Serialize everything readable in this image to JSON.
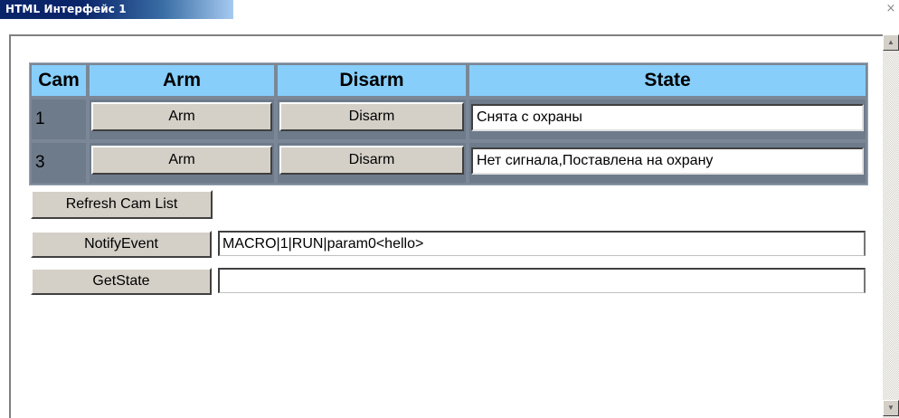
{
  "window": {
    "title": "HTML Интерфейс 1",
    "close_glyph": "×"
  },
  "scrollbar": {
    "up_glyph": "▲",
    "down_glyph": "▼"
  },
  "table": {
    "headers": [
      "Cam",
      "Arm",
      "Disarm",
      "State"
    ],
    "rows": [
      {
        "cam": "1",
        "arm_label": "Arm",
        "disarm_label": "Disarm",
        "state": "Снята с охраны"
      },
      {
        "cam": "3",
        "arm_label": "Arm",
        "disarm_label": "Disarm",
        "state": "Нет сигнала,Поставлена на охрану"
      }
    ]
  },
  "controls": {
    "refresh_label": "Refresh Cam List",
    "notify_label": "NotifyEvent",
    "notify_value": "MACRO|1|RUN|param0<hello>",
    "getstate_label": "GetState",
    "getstate_value": ""
  },
  "colors": {
    "header_bg": "#87cefa",
    "table_bg": "#6e7b8b",
    "button_face": "#d4d0c8",
    "titlebar": "#0a246a"
  }
}
